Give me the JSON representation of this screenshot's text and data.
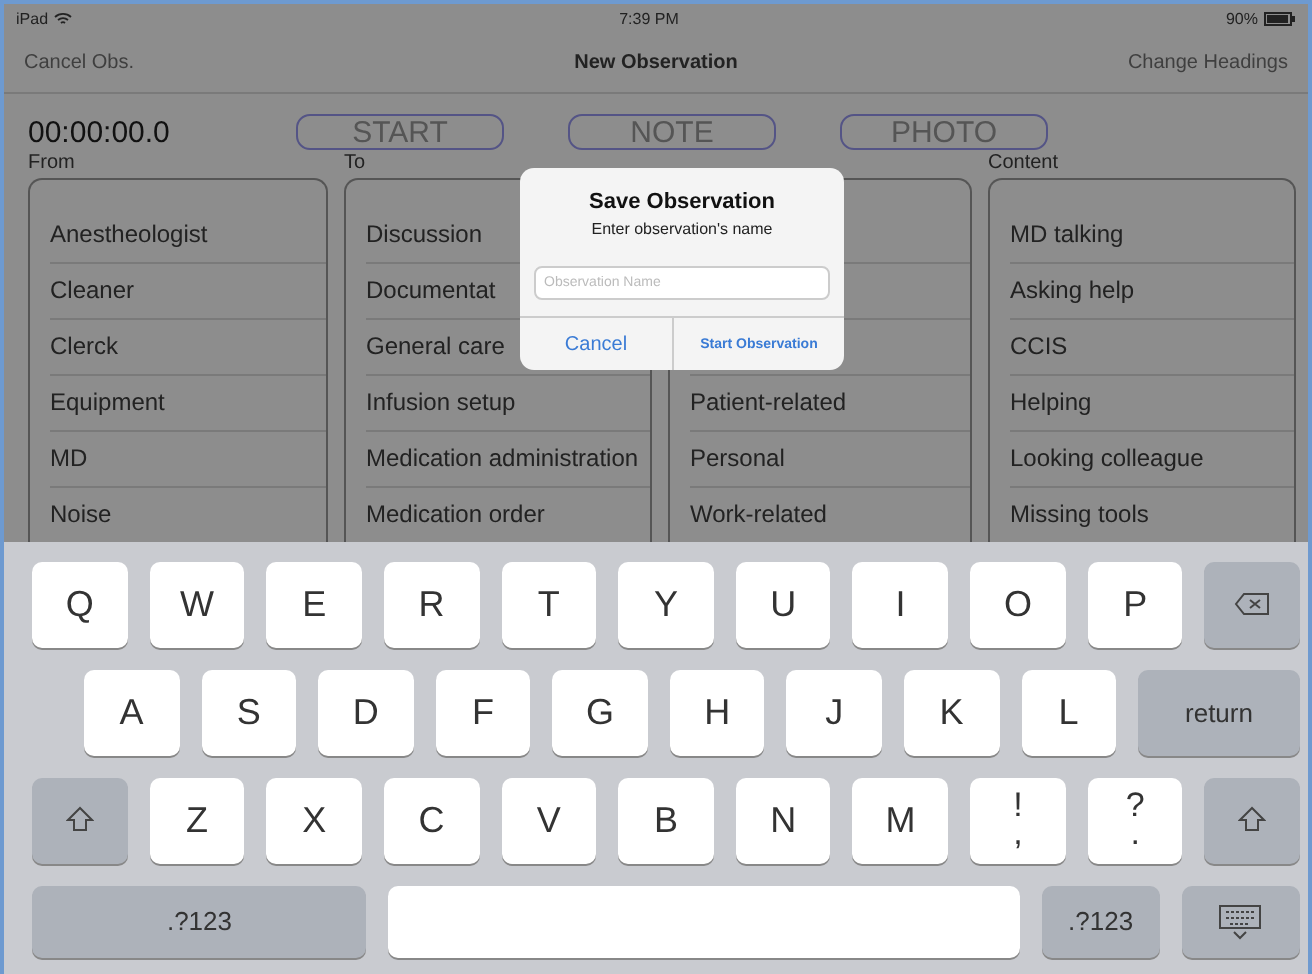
{
  "status_bar": {
    "device": "iPad",
    "time": "7:39 PM",
    "battery": "90%"
  },
  "nav_bar": {
    "left": "Cancel Obs.",
    "title": "New Observation",
    "right": "Change Headings"
  },
  "timer": "00:00:00.0",
  "actions": [
    "START",
    "NOTE",
    "PHOTO"
  ],
  "columns": [
    {
      "heading": "From",
      "items": [
        "Anestheologist",
        "Cleaner",
        "Clerck",
        "Equipment",
        "MD",
        "Noise"
      ]
    },
    {
      "heading": "To",
      "items": [
        "Discussion",
        "Documentat",
        "General care",
        "Infusion setup",
        "Medication administration",
        "Medication order"
      ]
    },
    {
      "items": [
        "Patient-related",
        "Personal",
        "Work-related"
      ]
    },
    {
      "heading": "Content",
      "items": [
        "MD talking",
        "Asking help",
        "CCIS",
        "Helping",
        "Looking colleague",
        "Missing tools"
      ]
    }
  ],
  "dialog": {
    "title": "Save Observation",
    "message": "Enter observation's name",
    "placeholder": "Observation Name",
    "buttons": [
      "Cancel",
      "Start Observation"
    ]
  },
  "keyboard": {
    "key_rows": [
      {
        "keys": [
          {
            "kind": "char",
            "label": "Q"
          },
          {
            "kind": "char",
            "label": "W"
          },
          {
            "kind": "char",
            "label": "E"
          },
          {
            "kind": "char",
            "label": "R"
          },
          {
            "kind": "char",
            "label": "T"
          },
          {
            "kind": "char",
            "label": "Y"
          },
          {
            "kind": "char",
            "label": "U"
          },
          {
            "kind": "char",
            "label": "I"
          },
          {
            "kind": "char",
            "label": "O"
          },
          {
            "kind": "char",
            "label": "P"
          },
          {
            "kind": "backspace"
          }
        ]
      },
      {
        "keys": [
          {
            "kind": "char",
            "label": "A"
          },
          {
            "kind": "char",
            "label": "S"
          },
          {
            "kind": "char",
            "label": "D"
          },
          {
            "kind": "char",
            "label": "F"
          },
          {
            "kind": "char",
            "label": "G"
          },
          {
            "kind": "char",
            "label": "H"
          },
          {
            "kind": "char",
            "label": "J"
          },
          {
            "kind": "char",
            "label": "K"
          },
          {
            "kind": "char",
            "label": "L"
          },
          {
            "kind": "wide",
            "label": "return"
          }
        ]
      },
      {
        "keys": [
          {
            "kind": "shift"
          },
          {
            "kind": "char",
            "label": "Z"
          },
          {
            "kind": "char",
            "label": "X"
          },
          {
            "kind": "char",
            "label": "C"
          },
          {
            "kind": "char",
            "label": "V"
          },
          {
            "kind": "char",
            "label": "B"
          },
          {
            "kind": "char",
            "label": "N"
          },
          {
            "kind": "char",
            "label": "M"
          },
          {
            "kind": "dual",
            "top": "!",
            "bottom": ","
          },
          {
            "kind": "dual",
            "top": "?",
            "bottom": "."
          },
          {
            "kind": "shift"
          }
        ]
      },
      {
        "keys": [
          {
            "kind": "mode",
            "label": ".?123"
          },
          {
            "kind": "space"
          },
          {
            "kind": "mode_small",
            "label": ".?123"
          },
          {
            "kind": "dismiss"
          }
        ]
      }
    ]
  }
}
